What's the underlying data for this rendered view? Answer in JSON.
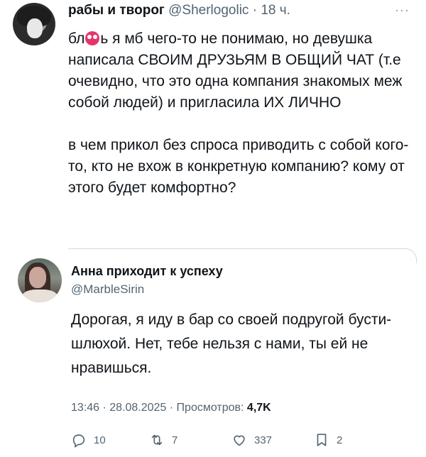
{
  "tweet": {
    "author_name": "рабы и творог",
    "author_handle": "@Sherlogolic",
    "time_ago": "18 ч.",
    "more_icon": "more-dots-icon",
    "text_before_emoji": "бл",
    "emoji": "pink-face-emoji",
    "text_after_emoji": "ь я мб чего-то не понимаю, но девушка написала СВОИМ ДРУЗЬЯМ В ОБЩИЙ ЧАТ (т.е очевидно, что это одна компания знакомых меж собой людей) и пригласила ИХ ЛИЧНО",
    "paragraph2": "в чем прикол без спроса приводить с собой кого-то, кто не вхож в конкретную компанию? кому от этого будет комфортно?"
  },
  "quoted": {
    "author_name": "Анна приходит к успеху",
    "author_handle": "@MarbleSirin",
    "text": "Дорогая, я иду в бар со своей подругой бусти-шлюхой. Нет, тебе нельзя с нами, ты ей не нравишься.",
    "timestamp": "13:46 · 28.08.2025 · Просмотров: ",
    "views": "4,7K"
  },
  "actions": {
    "replies": "10",
    "retweets": "7",
    "likes": "337",
    "bookmarks": "2"
  },
  "colors": {
    "text": "#0f1419",
    "secondary": "#536471",
    "border": "#cfd9de",
    "emoji": "#e8336a"
  }
}
